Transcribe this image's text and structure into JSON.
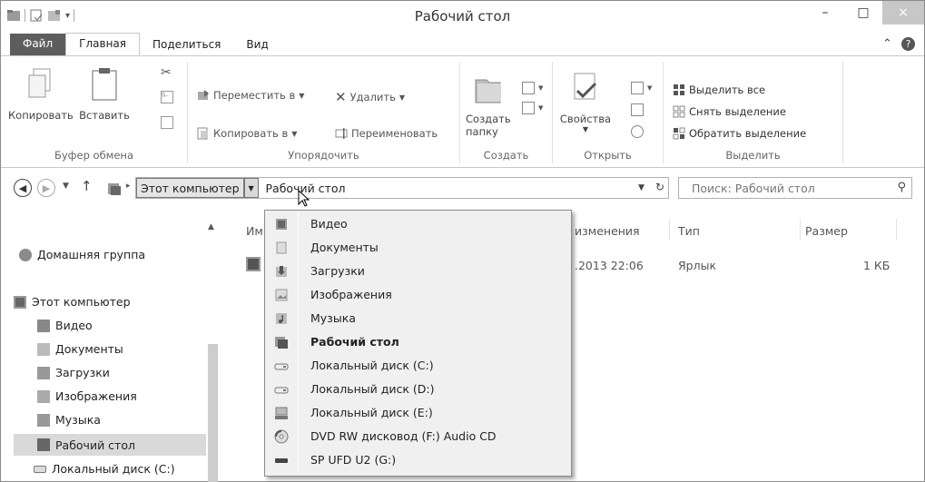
{
  "window": {
    "title": "Рабочий стол",
    "controls": {
      "minimize": "–",
      "maximize": "□",
      "close": "×"
    }
  },
  "ribbon_tabs": [
    {
      "label": "Файл"
    },
    {
      "label": "Главная"
    },
    {
      "label": "Поделиться"
    },
    {
      "label": "Вид"
    }
  ],
  "ribbon": {
    "clipboard": {
      "copy": "Копировать",
      "paste": "Вставить",
      "group": "Буфер обмена"
    },
    "organize": {
      "move_to": "Переместить в",
      "copy_to": "Копировать в",
      "delete": "Удалить",
      "rename": "Переименовать",
      "group": "Упорядочить"
    },
    "new": {
      "new_folder_1": "Создать",
      "new_folder_2": "папку",
      "group": "Создать"
    },
    "open": {
      "properties": "Свойства",
      "group": "Открыть"
    },
    "select": {
      "select_all": "Выделить все",
      "select_none": "Снять выделение",
      "invert": "Обратить выделение",
      "group": "Выделить"
    }
  },
  "address": {
    "crumb_computer": "Этот компьютер",
    "crumb_current": "Рабочий стол",
    "search_placeholder": "Поиск: Рабочий стол"
  },
  "nav_pane": {
    "homegroup": "Домашняя группа",
    "computer": "Этот компьютер",
    "items": [
      "Видео",
      "Документы",
      "Загрузки",
      "Изображения",
      "Музыка",
      "Рабочий стол",
      "Локальный диск (C:)"
    ]
  },
  "columns": {
    "name": "Им",
    "date": "изменения",
    "type": "Тип",
    "size": "Размер"
  },
  "file_row": {
    "date": ".2013 22:06",
    "type": "Ярлык",
    "size": "1 КБ"
  },
  "dropdown": [
    {
      "label": "Видео",
      "icon": "video-folder-icon"
    },
    {
      "label": "Документы",
      "icon": "documents-folder-icon"
    },
    {
      "label": "Загрузки",
      "icon": "downloads-folder-icon"
    },
    {
      "label": "Изображения",
      "icon": "pictures-folder-icon"
    },
    {
      "label": "Музыка",
      "icon": "music-folder-icon"
    },
    {
      "label": "Рабочий стол",
      "icon": "desktop-folder-icon",
      "current": true
    },
    {
      "label": "Локальный диск (C:)",
      "icon": "drive-icon"
    },
    {
      "label": "Локальный диск (D:)",
      "icon": "drive-icon"
    },
    {
      "label": "Локальный диск (E:)",
      "icon": "drive-icon"
    },
    {
      "label": "DVD RW дисковод (F:) Audio CD",
      "icon": "dvd-icon"
    },
    {
      "label": "SP UFD U2 (G:)",
      "icon": "usb-drive-icon"
    }
  ]
}
